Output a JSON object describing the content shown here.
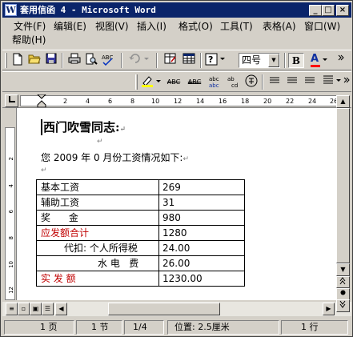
{
  "window": {
    "title": "套用信函 4 - Microsoft Word",
    "app_icon": "W",
    "minimize": "_",
    "maximize": "□",
    "close": "×"
  },
  "menu": [
    "文件(F)",
    "编辑(E)",
    "视图(V)",
    "插入(I)",
    "格式(O)",
    "工具(T)",
    "表格(A)",
    "窗口(W)",
    "帮助(H)"
  ],
  "toolbar": {
    "font_size": "四号",
    "bold": "B",
    "font_color_letter": "A",
    "zoom_hint": "?"
  },
  "ruler": {
    "numbers": [
      "2",
      "4",
      "6",
      "8",
      "10",
      "12",
      "14",
      "16",
      "18",
      "20",
      "22",
      "24",
      "26"
    ]
  },
  "vruler": {
    "numbers": [
      "2",
      "4",
      "6",
      "8",
      "10",
      "12"
    ]
  },
  "document": {
    "salutation": "西门吹雪同志:",
    "intro": "您 2009 年 0 月份工资情况如下:",
    "table": [
      {
        "label": "基本工资",
        "value": "269",
        "label_color": "#000000"
      },
      {
        "label": "辅助工资",
        "value": "31",
        "label_color": "#000000"
      },
      {
        "label": "奖      金",
        "value": "980",
        "label_color": "#000000"
      },
      {
        "label": "应发额合计",
        "value": "1280",
        "label_color": "#c00000"
      },
      {
        "label": "代扣: 个人所得税",
        "value": "24.00",
        "label_color": "#000000"
      },
      {
        "label": "水 电   费",
        "value": "26.00",
        "label_color": "#000000"
      },
      {
        "label": "实 发 额",
        "value": "1230.00",
        "label_color": "#c00000"
      }
    ]
  },
  "statusbar": {
    "page": "1 页",
    "section": "1 节",
    "page_of": "1/4",
    "position": "位置: 2.5厘米",
    "line": "1 行"
  },
  "colors": {
    "title_bar": "#0a246a",
    "accent_red": "#c00000",
    "font_color_underline": "#ff0000"
  }
}
